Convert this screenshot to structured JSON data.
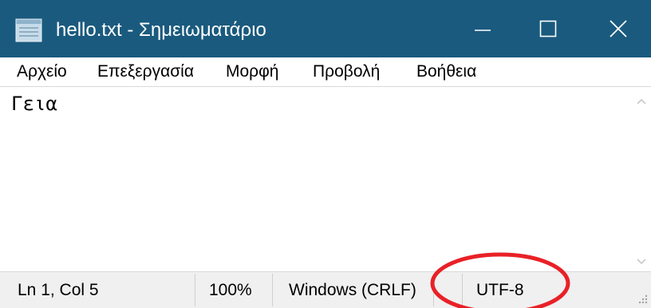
{
  "window": {
    "title": "hello.txt - Σημειωματάριο",
    "titlebar_color": "#1a5a7e"
  },
  "controls": {
    "minimize_icon": "minimize-icon",
    "maximize_icon": "maximize-icon",
    "close_icon": "close-icon"
  },
  "menu": {
    "items": [
      {
        "label": "Αρχείο"
      },
      {
        "label": "Επεξεργασία"
      },
      {
        "label": "Μορφή"
      },
      {
        "label": "Προβολή"
      },
      {
        "label": "Βοήθεια"
      }
    ]
  },
  "editor": {
    "content": "Γεια"
  },
  "status": {
    "position": "Ln 1, Col 5",
    "zoom": "100%",
    "line_ending": "Windows (CRLF)",
    "encoding": "UTF-8"
  },
  "annotation": {
    "color": "#e82127"
  }
}
